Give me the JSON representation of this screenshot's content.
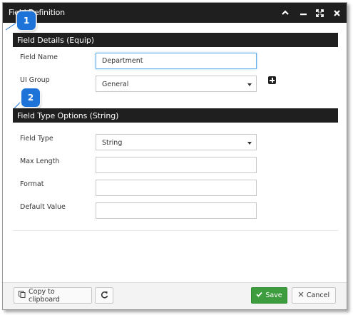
{
  "dialog": {
    "title": "Field Definition"
  },
  "markers": {
    "one": "1",
    "two": "2"
  },
  "section1": {
    "title": "Field Details (Equip)",
    "field_name_label": "Field Name",
    "field_name_value": "Department",
    "ui_group_label": "UI Group",
    "ui_group_value": "General"
  },
  "section2": {
    "title": "Field Type Options (String)",
    "field_type_label": "Field Type",
    "field_type_value": "String",
    "max_length_label": "Max Length",
    "max_length_value": "",
    "format_label": "Format",
    "format_value": "",
    "default_value_label": "Default Value",
    "default_value_value": ""
  },
  "footer": {
    "copy_label": "Copy to clipboard",
    "save_label": "Save",
    "cancel_label": "Cancel"
  },
  "icons": {
    "collapse": "chevron-up-icon",
    "minimize": "minimize-icon",
    "maximize": "expand-icon",
    "close": "close-icon",
    "add": "plus-square-icon",
    "copy": "copy-icon",
    "refresh": "refresh-icon",
    "save": "check-icon",
    "cancel": "x-icon"
  },
  "colors": {
    "header_bg": "#1f1f1f",
    "save_bg": "#3d9c3d",
    "marker_bg": "#1e73d8"
  }
}
